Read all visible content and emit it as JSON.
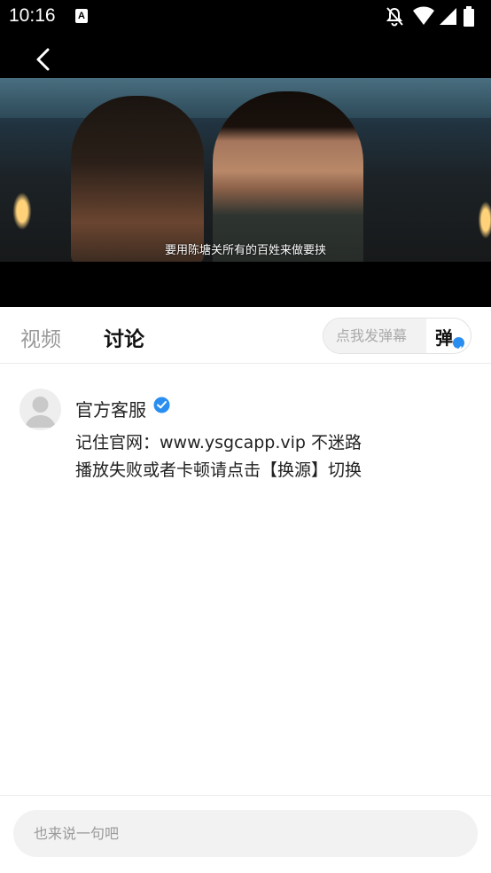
{
  "status_bar": {
    "time": "10:16",
    "notification_icon_label": "A",
    "icons": [
      "notifications-off-icon",
      "wifi-icon",
      "signal-icon",
      "battery-icon"
    ]
  },
  "player": {
    "subtitle": "要用陈塘关所有的百姓来做要挟"
  },
  "tabs": [
    {
      "label": "视频",
      "active": false
    },
    {
      "label": "讨论",
      "active": true
    }
  ],
  "danmaku": {
    "placeholder": "点我发弹幕",
    "toggle_label": "弹"
  },
  "comments": [
    {
      "author": "官方客服",
      "verified": true,
      "lines": [
        "记住官网：www.ysgcapp.vip 不迷路",
        "播放失败或者卡顿请点击【换源】切换"
      ]
    }
  ],
  "composer": {
    "placeholder": "也来说一句吧"
  },
  "colors": {
    "accent": "#2a8ef0",
    "inactive_tab": "#999999"
  }
}
